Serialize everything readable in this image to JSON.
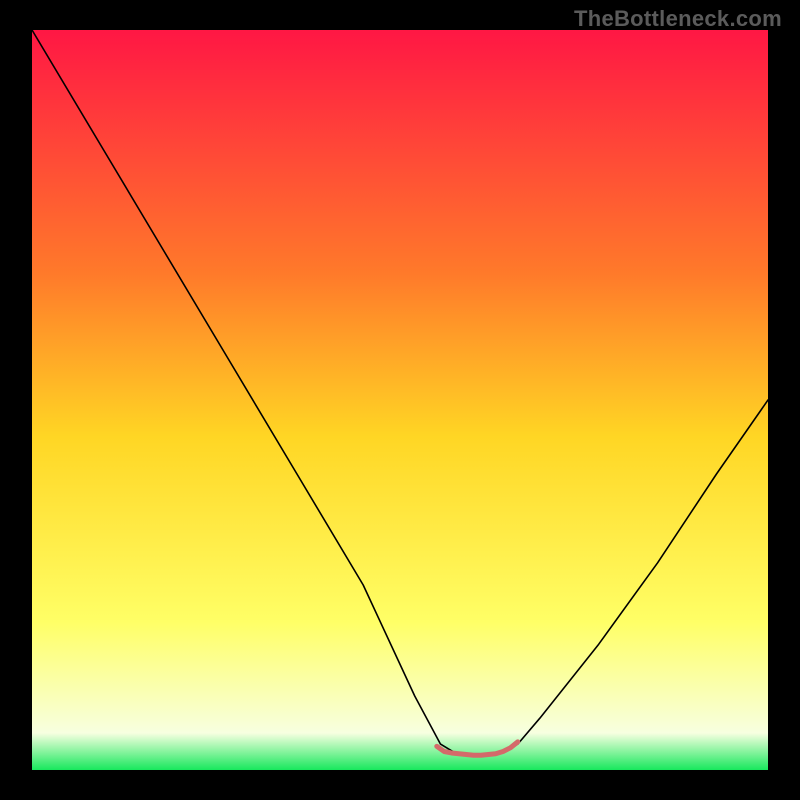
{
  "watermark": "TheBottleneck.com",
  "chart_data": {
    "type": "line",
    "title": "",
    "xlabel": "",
    "ylabel": "",
    "xlim": [
      0,
      100
    ],
    "ylim": [
      0,
      100
    ],
    "grid": false,
    "background_gradient_stops": [
      {
        "offset": 0,
        "color": "#ff1744"
      },
      {
        "offset": 0.33,
        "color": "#ff7a2a"
      },
      {
        "offset": 0.55,
        "color": "#ffd624"
      },
      {
        "offset": 0.8,
        "color": "#ffff66"
      },
      {
        "offset": 0.95,
        "color": "#f7ffe0"
      },
      {
        "offset": 1.0,
        "color": "#18e85d"
      }
    ],
    "series": [
      {
        "name": "bottleneck-curve",
        "color": "#000000",
        "width": 1.6,
        "points": [
          {
            "x": 0,
            "y": 100
          },
          {
            "x": 9,
            "y": 85
          },
          {
            "x": 18,
            "y": 70
          },
          {
            "x": 27,
            "y": 55
          },
          {
            "x": 36,
            "y": 40
          },
          {
            "x": 45,
            "y": 25
          },
          {
            "x": 52,
            "y": 10
          },
          {
            "x": 55.5,
            "y": 3.5
          },
          {
            "x": 58,
            "y": 2
          },
          {
            "x": 63,
            "y": 2
          },
          {
            "x": 66,
            "y": 3.5
          },
          {
            "x": 69,
            "y": 7
          },
          {
            "x": 77,
            "y": 17
          },
          {
            "x": 85,
            "y": 28
          },
          {
            "x": 93,
            "y": 40
          },
          {
            "x": 100,
            "y": 50
          }
        ]
      },
      {
        "name": "optimal-zone-marker",
        "color": "#d46a6a",
        "width": 5,
        "points": [
          {
            "x": 55,
            "y": 3.2
          },
          {
            "x": 56,
            "y": 2.5
          },
          {
            "x": 57,
            "y": 2.3
          },
          {
            "x": 58,
            "y": 2.2
          },
          {
            "x": 59,
            "y": 2.1
          },
          {
            "x": 60,
            "y": 2.0
          },
          {
            "x": 61,
            "y": 2.0
          },
          {
            "x": 62,
            "y": 2.1
          },
          {
            "x": 63,
            "y": 2.2
          },
          {
            "x": 64,
            "y": 2.5
          },
          {
            "x": 65,
            "y": 3.0
          },
          {
            "x": 66,
            "y": 3.8
          }
        ]
      }
    ]
  }
}
